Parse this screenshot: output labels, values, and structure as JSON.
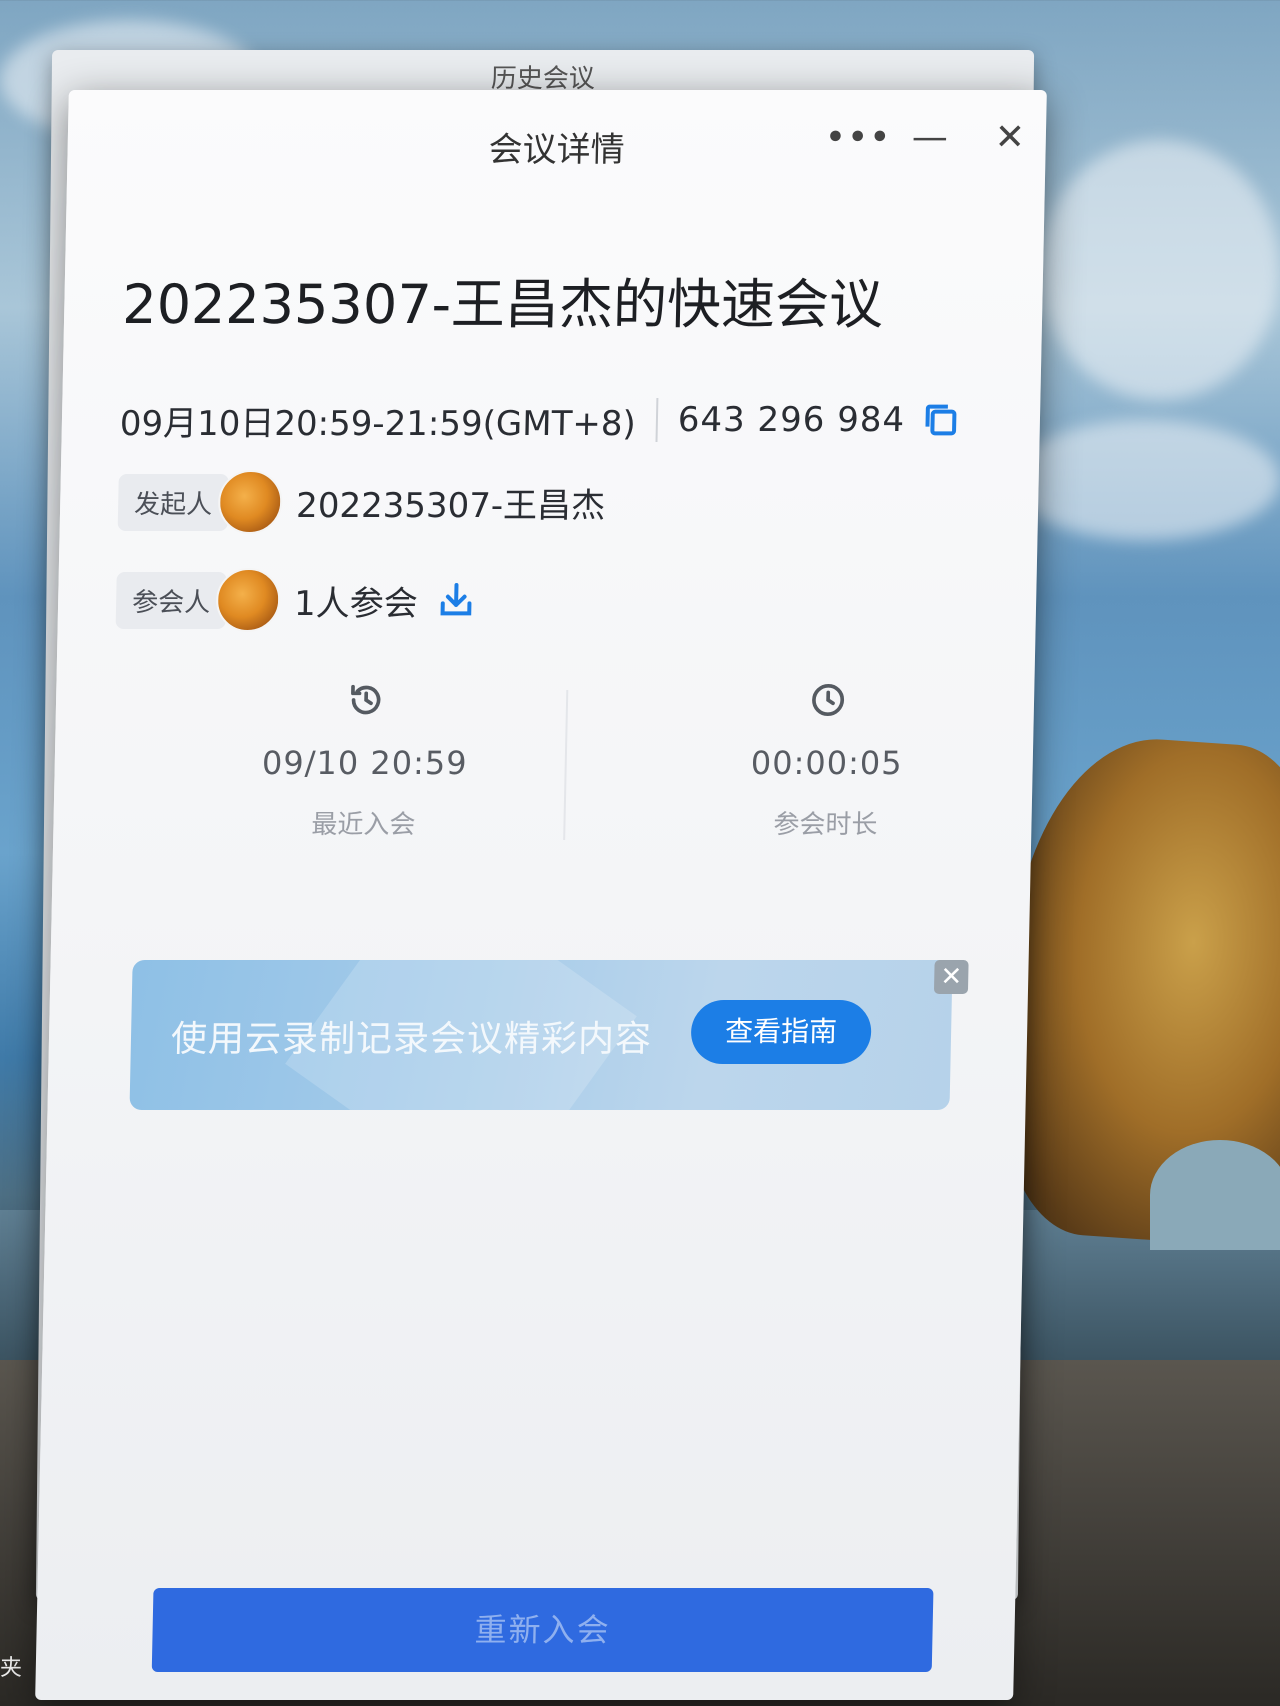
{
  "desktop": {
    "side_text": "夹"
  },
  "back_window": {
    "title": "历史会议"
  },
  "window": {
    "title": "会议详情",
    "controls": {
      "more": "•••",
      "minimize": "—",
      "close": "✕"
    }
  },
  "meeting": {
    "title": "202235307-王昌杰的快速会议",
    "time": "09月10日20:59-21:59(GMT+8)",
    "id": "643 296 984"
  },
  "host": {
    "tag": "发起人",
    "name": "202235307-王昌杰"
  },
  "attendees": {
    "tag": "参会人",
    "count_text": "1人参会"
  },
  "stats": {
    "recent": {
      "value": "09/10 20:59",
      "label": "最近入会"
    },
    "duration": {
      "value": "00:00:05",
      "label": "参会时长"
    }
  },
  "banner": {
    "text": "使用云录制记录会议精彩内容",
    "button": "查看指南",
    "close": "✕"
  },
  "rejoin": {
    "label": "重新入会"
  },
  "colors": {
    "accent": "#1c7ee6",
    "primary_button": "#2f6ae0"
  }
}
